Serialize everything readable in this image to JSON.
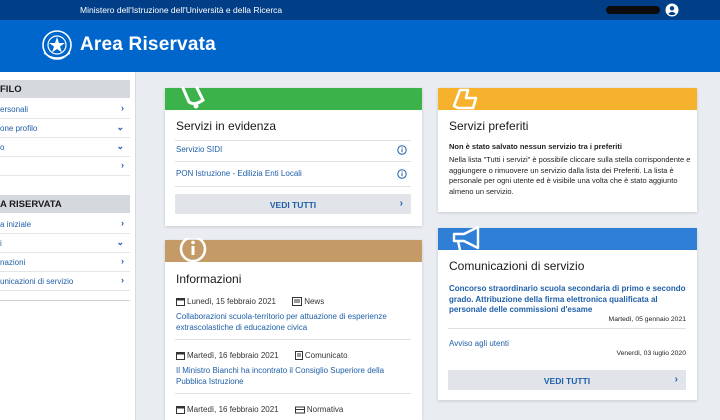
{
  "topbar": {
    "ministry": "Ministero dell'Istruzione dell'Università e della Ricerca"
  },
  "header": {
    "title": "Area Riservata"
  },
  "sidebar": {
    "section1": "FILO",
    "items1": [
      "ersonali",
      "one profilo",
      "o",
      ""
    ],
    "section2": "A RISERVATA",
    "items2": [
      "a iniziale",
      "i",
      "nazioni",
      "unicazioni di servizio"
    ]
  },
  "evidenza": {
    "title": "Servizi in evidenza",
    "items": [
      "Servizio SIDI",
      "PON Istruzione - Edilizia Enti Locali"
    ],
    "button": "VEDI TUTTI",
    "band_color": "#3bb34a"
  },
  "preferiti": {
    "title": "Servizi preferiti",
    "subtitle": "Non è stato salvato nessun servizio tra i preferiti",
    "body": "Nella lista \"Tutti i servizi\" è possibile cliccare sulla stella corrispondente e aggiungere o rimuovere un servizio dalla lista dei Preferiti. La lista è personale per ogni utente ed è visibile una volta che è stato aggiunto almeno un servizio.",
    "band_color": "#f6b12d"
  },
  "informazioni": {
    "title": "Informazioni",
    "band_color": "#c49a66",
    "items": [
      {
        "date": "Lunedì, 15 febbraio 2021",
        "type": "News",
        "text": "Collaborazioni scuola-territorio per attuazione di esperienze extrascolastiche di educazione civica"
      },
      {
        "date": "Martedì, 16 febbraio 2021",
        "type": "Comunicato",
        "text": "Il Ministro Bianchi ha incontrato il Consiglio Superiore della Pubblica Istruzione"
      },
      {
        "date": "Martedì, 16 febbraio 2021",
        "type": "Normativa",
        "text": ""
      }
    ]
  },
  "comunicazioni": {
    "title": "Comunicazioni di servizio",
    "band_color": "#2f7fd6",
    "items": [
      {
        "text": "Concorso straordinario scuola secondaria di primo e secondo grado. Attribuzione della firma elettronica qualificata al personale delle commissioni d'esame",
        "date": "Martedì, 05 gennaio 2021"
      },
      {
        "text": "Avviso agli utenti",
        "date": "Venerdì, 03 luglio 2020"
      }
    ],
    "button": "VEDI TUTTI"
  }
}
